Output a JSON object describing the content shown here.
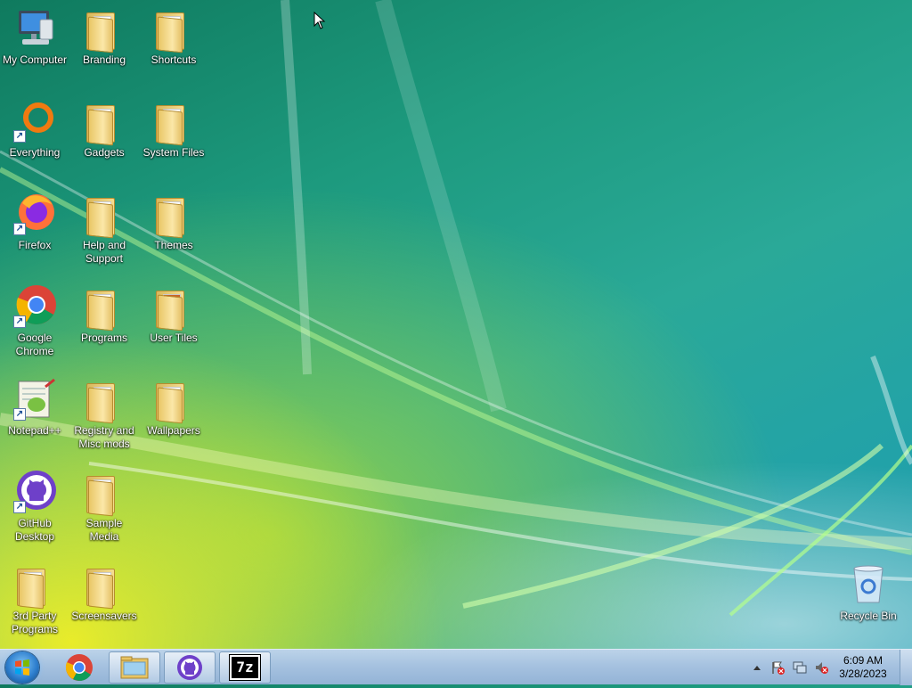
{
  "desktop": {
    "icons": [
      {
        "label": "My Computer",
        "icon": "computer-icon"
      },
      {
        "label": "Branding",
        "icon": "folder-icon"
      },
      {
        "label": "Shortcuts",
        "icon": "folder-icon"
      },
      {
        "label": "Everything",
        "icon": "everything-app-icon"
      },
      {
        "label": "Gadgets",
        "icon": "folder-icon"
      },
      {
        "label": "System Files",
        "icon": "folder-icon"
      },
      {
        "label": "Firefox",
        "icon": "firefox-icon"
      },
      {
        "label": "Help and\nSupport",
        "icon": "folder-icon"
      },
      {
        "label": "Themes",
        "icon": "folder-icon"
      },
      {
        "label": "Google\nChrome",
        "icon": "chrome-icon"
      },
      {
        "label": "Programs",
        "icon": "folder-icon"
      },
      {
        "label": "User Tiles",
        "icon": "folder-icon"
      },
      {
        "label": "Notepad++",
        "icon": "notepad-plus-plus-icon"
      },
      {
        "label": "Registry and\nMisc mods",
        "icon": "folder-icon"
      },
      {
        "label": "Wallpapers",
        "icon": "folder-icon"
      },
      {
        "label": "GitHub\nDesktop",
        "icon": "github-desktop-icon"
      },
      {
        "label": "Sample\nMedia",
        "icon": "folder-icon"
      },
      {
        "label": "3rd Party\nPrograms",
        "icon": "folder-icon"
      },
      {
        "label": "Screensavers",
        "icon": "folder-icon"
      },
      {
        "label": "Recycle Bin",
        "icon": "recycle-bin-icon"
      }
    ]
  },
  "taskbar": {
    "start_icon": "windows-logo-icon",
    "pinned": [
      {
        "icon": "chrome-icon"
      },
      {
        "icon": "file-explorer-icon"
      },
      {
        "icon": "github-desktop-icon"
      },
      {
        "icon": "7zip-icon",
        "text": "7z"
      }
    ],
    "tray": {
      "icons": [
        "show-hidden-icons-arrow",
        "action-center-flag-icon",
        "network-icon",
        "volume-muted-icon"
      ],
      "time": "6:09 AM",
      "date": "3/28/2023"
    }
  },
  "colors": {
    "taskbar": "#a6c2e0",
    "wallpaper_teal": "#1d9a7e",
    "wallpaper_yellow": "#e9ec2a"
  }
}
